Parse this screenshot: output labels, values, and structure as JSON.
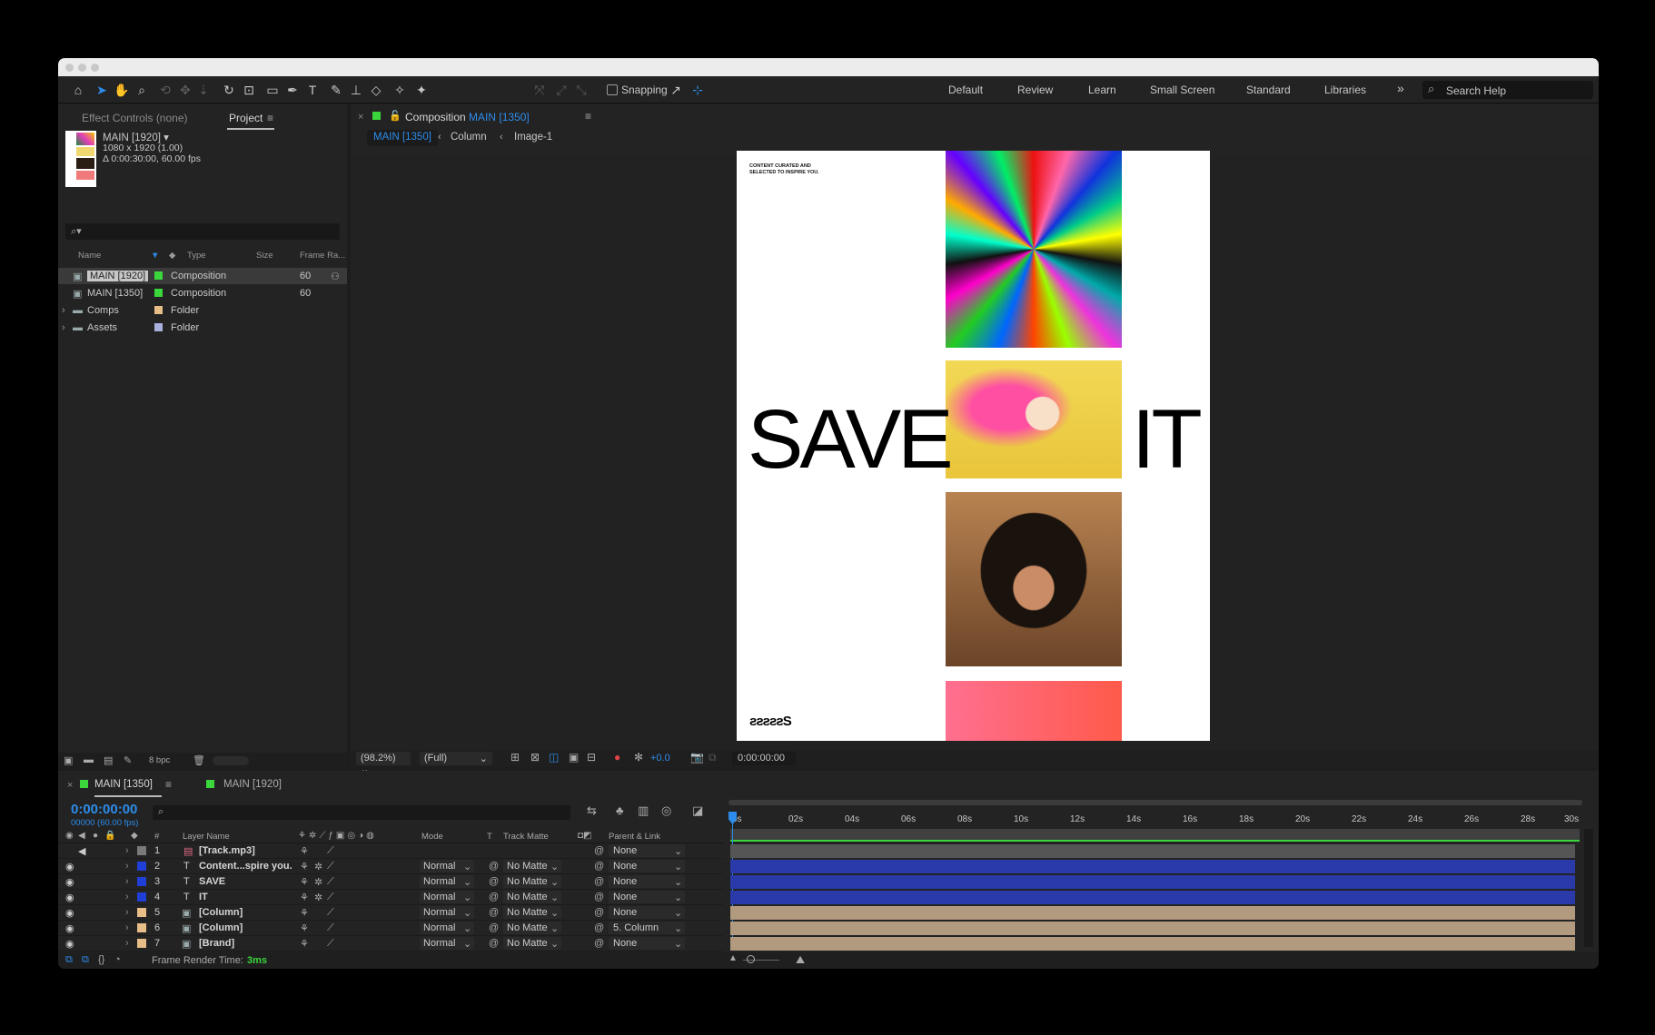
{
  "toolbar": {
    "snapping_label": "Snapping",
    "workspaces": [
      "Default",
      "Review",
      "Learn",
      "Small Screen",
      "Standard",
      "Libraries"
    ],
    "more_label": "»",
    "search_placeholder": "Search Help"
  },
  "left_panel": {
    "tab_effect_controls": "Effect Controls (none)",
    "tab_project": "Project",
    "selected_item": {
      "name": "MAIN [1920] ▾",
      "dimensions": "1080 x 1920 (1.00)",
      "duration": "Δ 0:00:30:00, 60.00 fps"
    },
    "search_placeholder": "⌕▾",
    "columns": {
      "name": "Name",
      "type": "Type",
      "size": "Size",
      "frame_rate": "Frame Ra..."
    },
    "items": [
      {
        "name": "MAIN [1920]",
        "type": "Composition",
        "frame_rate": "60",
        "label_color": "#3bd63b",
        "kind": "comp"
      },
      {
        "name": "MAIN [1350]",
        "type": "Composition",
        "frame_rate": "60",
        "label_color": "#3bd63b",
        "kind": "comp"
      },
      {
        "name": "Comps",
        "type": "Folder",
        "frame_rate": "",
        "label_color": "#e7bd88",
        "kind": "folder"
      },
      {
        "name": "Assets",
        "type": "Folder",
        "frame_rate": "",
        "label_color": "#a9b0de",
        "kind": "folder"
      }
    ],
    "bpc": "8 bpc"
  },
  "composition_panel": {
    "tab_prefix": "Composition",
    "tab_name": "MAIN [1350]",
    "breadcrumbs": [
      "MAIN [1350]",
      "Column",
      "Image-1"
    ],
    "zoom": "(98.2%)",
    "resolution": "(Full)",
    "exposure": "+0.0",
    "timecode": "0:00:00:00"
  },
  "artboard": {
    "small_text_line1": "CONTENT CURATED AND",
    "small_text_line2": "SELECTED TO INSPIRE YOU.",
    "headline_left": "SAVE",
    "headline_right": "IT",
    "logo_text": "ƨƨƨƨƨS"
  },
  "timeline": {
    "tab_active": "MAIN [1350]",
    "tab_other": "MAIN [1920]",
    "current_time": "0:00:00:00",
    "frame_info": "00000 (60.00 fps)",
    "col_number": "#",
    "col_layer_name": "Layer Name",
    "col_mode": "Mode",
    "col_t": "T",
    "col_track_matte": "Track Matte",
    "col_parent": "Parent & Link",
    "ruler": [
      "0s",
      "02s",
      "04s",
      "06s",
      "08s",
      "10s",
      "12s",
      "14s",
      "16s",
      "18s",
      "20s",
      "22s",
      "24s",
      "26s",
      "28s",
      "30s"
    ],
    "layers": [
      {
        "num": "1",
        "name": "[Track.mp3]",
        "kind": "audio",
        "mode": "",
        "matte": "",
        "parent": "None",
        "label_color": "#7a7a7a",
        "bar_color": "#555555"
      },
      {
        "num": "2",
        "name": "Content...spire you.",
        "kind": "text",
        "mode": "Normal",
        "matte": "No Matte",
        "parent": "None",
        "label_color": "#1f3fd6",
        "bar_color": "#2a3aa8"
      },
      {
        "num": "3",
        "name": "SAVE",
        "kind": "text",
        "mode": "Normal",
        "matte": "No Matte",
        "parent": "None",
        "label_color": "#1f3fd6",
        "bar_color": "#2a3aa8"
      },
      {
        "num": "4",
        "name": "IT",
        "kind": "text",
        "mode": "Normal",
        "matte": "No Matte",
        "parent": "None",
        "label_color": "#1f3fd6",
        "bar_color": "#2a3aa8"
      },
      {
        "num": "5",
        "name": "[Column]",
        "kind": "comp",
        "mode": "Normal",
        "matte": "No Matte",
        "parent": "None",
        "label_color": "#e7bd88",
        "bar_color": "#b29a7f"
      },
      {
        "num": "6",
        "name": "[Column]",
        "kind": "comp",
        "mode": "Normal",
        "matte": "No Matte",
        "parent": "5. Column",
        "label_color": "#e7bd88",
        "bar_color": "#b29a7f"
      },
      {
        "num": "7",
        "name": "[Brand]",
        "kind": "comp",
        "mode": "Normal",
        "matte": "No Matte",
        "parent": "None",
        "label_color": "#e7bd88",
        "bar_color": "#b29a7f"
      }
    ],
    "render_time_label": "Frame Render Time:",
    "render_time_value": "3ms"
  },
  "colors": {
    "accent": "#2d8ceb",
    "green": "#3bd63b"
  }
}
